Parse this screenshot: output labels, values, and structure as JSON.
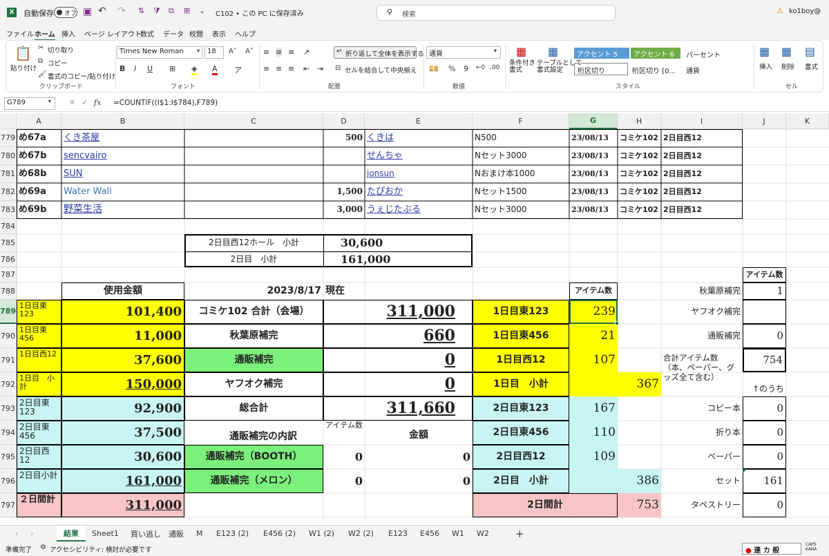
{
  "titlebar": {
    "autosave": "自動保存",
    "toggle": "オフ",
    "doc": "C102 • この PC に保存済み",
    "search": "検索",
    "user": "ko1boy@"
  },
  "menu": [
    "ファイル",
    "ホーム",
    "挿入",
    "ページ レイアウト",
    "数式",
    "データ",
    "校閲",
    "表示",
    "ヘルプ"
  ],
  "ribbon": {
    "cut": "切り取り",
    "copy": "コピー",
    "fmtpaint": "書式のコピー/貼り付け",
    "paste": "貼り付け",
    "g_clip": "クリップボード",
    "font": "Times New Roman",
    "size": "18",
    "g_font": "フォント",
    "wrap": "折り返して全体を表示する",
    "merge": "セルを結合して中央揃え",
    "g_align": "配置",
    "numfmt": "通貨",
    "g_num": "数値",
    "cond": "条件付き\n書式",
    "table": "テーブルとして\n書式設定",
    "styles": [
      "アクセント 5",
      "アクセント 6",
      "パーセント",
      "桁区切り",
      "桁区切り [0...",
      "通貨"
    ],
    "g_style": "スタイル",
    "insert": "挿入",
    "delete": "削除",
    "format": "書式",
    "g_cell": "セル"
  },
  "formula_bar": {
    "namebox": "G789",
    "fx": "fx",
    "formula": "=COUNTIF((I$1:I$784),F789)"
  },
  "columns": [
    "A",
    "B",
    "C",
    "D",
    "E",
    "F",
    "G",
    "H",
    "I",
    "J",
    "K"
  ],
  "rows": [
    "779",
    "780",
    "781",
    "782",
    "783",
    "784",
    "785",
    "786",
    "787",
    "788",
    "789",
    "790",
    "791",
    "792",
    "793",
    "794",
    "795",
    "796",
    "797"
  ],
  "selected_row": "789",
  "selected_col": "G",
  "cells": {
    "a779": "め67a",
    "b779": "くき茶屋",
    "d779": "500",
    "e779": "くきは",
    "f779": "N500",
    "g779": "23/08/13",
    "h779": "コミケ102",
    "i779": "2日目西12",
    "a780": "め67b",
    "b780": "sencvairo",
    "e780": "せんちゃ",
    "f780": "Nセット3000",
    "g780": "23/08/13",
    "h780": "コミケ102",
    "i780": "2日目西12",
    "a781": "め68b",
    "b781": "SUN",
    "e781": "jonsun",
    "f781": "Nおまけ本1000",
    "g781": "23/08/13",
    "h781": "コミケ102",
    "i781": "2日目西12",
    "a782": "め69a",
    "b782": "Water Wall",
    "d782": "1,500",
    "e782": "たぴおか",
    "f782": "Nセット1500",
    "g782": "23/08/13",
    "h782": "コミケ102",
    "i782": "2日目西12",
    "a783": "め69b",
    "b783": "野菜生活",
    "d783": "3,000",
    "e783": "うぇじたぶる",
    "f783": "Nセット3000",
    "g783": "23/08/13",
    "h783": "コミケ102",
    "i783": "2日目西12",
    "c785": "2日目西12ホール　小計",
    "d785": "30,600",
    "c786": "2日目　小計",
    "d786": "161,000",
    "j787": "アイテム数",
    "b788": "使用金額",
    "c788": "2023/8/17",
    "d788": "現在",
    "g788": "アイテム数",
    "i788": "秋葉原補完",
    "j788": "1",
    "a789": "1日目東123",
    "b789": "101,400",
    "c789": "コミケ102 合計（会場）",
    "e789": "311,000",
    "f789": "1日目東123",
    "g789": "239",
    "i789": "ヤフオク補完",
    "a790": "1日目東456",
    "b790": "11,000",
    "c790": "秋葉原補完",
    "e790": "660",
    "f790": "1日目東456",
    "g790": "21",
    "i790": "通販補完",
    "j790": "0",
    "a791": "1日目西12",
    "b791": "37,600",
    "c791": "通販補完",
    "e791": "0",
    "f791": "1日目西12",
    "g791": "107",
    "i791": "合計アイテム数（本、ペーパー、グッズ全て含む）",
    "j791": "754",
    "a792": "1日目　小計",
    "b792": "150,000",
    "c792": "ヤフオク補完",
    "e792": "0",
    "f792": "1日目　小計",
    "h792": "367",
    "j792": "↑のうち",
    "a793": "2日目東123",
    "b793": "92,900",
    "c793": "総合計",
    "e793": "311,660",
    "f793": "2日目東123",
    "g793": "167",
    "i793": "コピー本",
    "j793": "0",
    "a794": "2日目東456",
    "b794": "37,500",
    "c794": "通販補完の内訳",
    "d794": "アイテム数",
    "e794": "金額",
    "f794": "2日目東456",
    "g794": "110",
    "i794": "折り本",
    "j794": "0",
    "a795": "2日目西12",
    "b795": "30,600",
    "c795": "通販補完（BOOTH）",
    "d795": "0",
    "e795": "0",
    "f795": "2日目西12",
    "g795": "109",
    "i795": "ペーパー",
    "j795": "0",
    "a796": "2日目小計",
    "b796": "161,000",
    "c796": "通販補完（メロン）",
    "d796": "0",
    "e796": "0",
    "f796": "2日目　小計",
    "h796": "386",
    "i796": "セット",
    "j796": "161",
    "a797": "２日間計",
    "b797": "311,000",
    "f797": "2日間計",
    "h797": "753",
    "i797": "タペストリー",
    "j797": "0"
  },
  "sheet_tabs": [
    "結果",
    "Sheet1",
    "買い逃し",
    "通販",
    "M",
    "E123 (2)",
    "E456 (2)",
    "W1 (2)",
    "W2 (2)",
    "E123",
    "E456",
    "W1",
    "W2"
  ],
  "active_tab": "結果",
  "status": {
    "ready": "準備完了",
    "access": "アクセシビリティ: 検討が必要です",
    "ime": "連 カ 般"
  },
  "colors": {
    "yellow": "#ffff00",
    "cyan": "#c8f4f4",
    "green": "#7bf07b",
    "pink": "#f7c5c5",
    "excel_green": "#217346"
  }
}
